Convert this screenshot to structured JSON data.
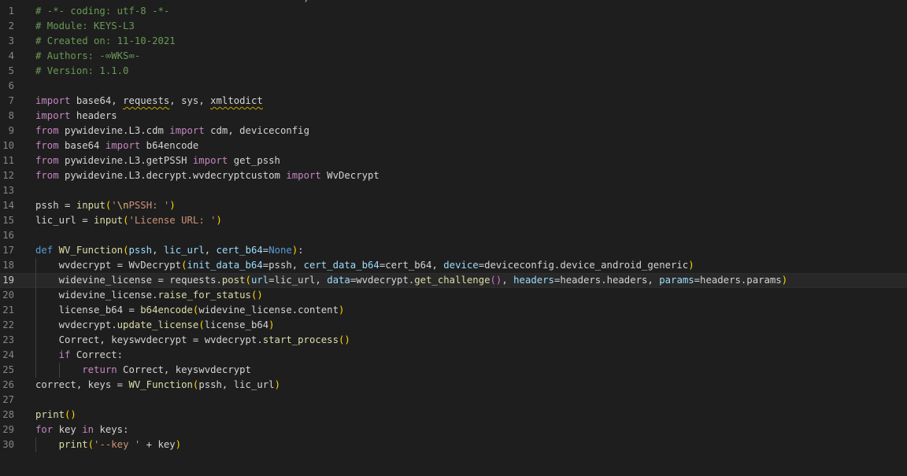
{
  "colors": {
    "background": "#1e1e1e",
    "comment": "#6a9955",
    "keyword": "#c586c0",
    "keyword_blue": "#569cd6",
    "variable": "#9cdcfe",
    "function": "#dcdcaa",
    "string": "#ce9178",
    "escape": "#d7ba7d",
    "bracket": "#ffd700",
    "bracket_inner": "#da70d6",
    "text": "#d4d4d4",
    "line_number": "#858585",
    "warning_squiggle": "#cca700"
  },
  "editor": {
    "clipped_top_text": "                                              )",
    "current_line": 19,
    "lines": [
      {
        "num": "1",
        "indent": 0,
        "tokens": [
          {
            "t": "# -*- coding: utf-8 -*-",
            "c": "comment"
          }
        ]
      },
      {
        "num": "2",
        "indent": 0,
        "tokens": [
          {
            "t": "# Module: KEYS-L3",
            "c": "comment"
          }
        ]
      },
      {
        "num": "3",
        "indent": 0,
        "tokens": [
          {
            "t": "# Created on: 11-10-2021",
            "c": "comment"
          }
        ]
      },
      {
        "num": "4",
        "indent": 0,
        "tokens": [
          {
            "t": "# Authors: -∞WKS∞-",
            "c": "comment"
          }
        ]
      },
      {
        "num": "5",
        "indent": 0,
        "tokens": [
          {
            "t": "# Version: 1.1.0",
            "c": "comment"
          }
        ]
      },
      {
        "num": "6",
        "indent": 0,
        "tokens": []
      },
      {
        "num": "7",
        "indent": 0,
        "tokens": [
          {
            "t": "import",
            "c": "keyword"
          },
          {
            "t": " base64, ",
            "c": "text"
          },
          {
            "t": "requests",
            "c": "text",
            "squiggle": true
          },
          {
            "t": ", sys, ",
            "c": "text"
          },
          {
            "t": "xmltodict",
            "c": "text",
            "squiggle": true
          }
        ]
      },
      {
        "num": "8",
        "indent": 0,
        "tokens": [
          {
            "t": "import",
            "c": "keyword"
          },
          {
            "t": " headers",
            "c": "text"
          }
        ]
      },
      {
        "num": "9",
        "indent": 0,
        "tokens": [
          {
            "t": "from",
            "c": "keyword"
          },
          {
            "t": " pywidevine.L3.cdm ",
            "c": "text"
          },
          {
            "t": "import",
            "c": "keyword"
          },
          {
            "t": " cdm, deviceconfig",
            "c": "text"
          }
        ]
      },
      {
        "num": "10",
        "indent": 0,
        "tokens": [
          {
            "t": "from",
            "c": "keyword"
          },
          {
            "t": " base64 ",
            "c": "text"
          },
          {
            "t": "import",
            "c": "keyword"
          },
          {
            "t": " b64encode",
            "c": "text"
          }
        ]
      },
      {
        "num": "11",
        "indent": 0,
        "tokens": [
          {
            "t": "from",
            "c": "keyword"
          },
          {
            "t": " pywidevine.L3.getPSSH ",
            "c": "text"
          },
          {
            "t": "import",
            "c": "keyword"
          },
          {
            "t": " get_pssh",
            "c": "text"
          }
        ]
      },
      {
        "num": "12",
        "indent": 0,
        "tokens": [
          {
            "t": "from",
            "c": "keyword"
          },
          {
            "t": " pywidevine.L3.decrypt.wvdecryptcustom ",
            "c": "text"
          },
          {
            "t": "import",
            "c": "keyword"
          },
          {
            "t": " WvDecrypt",
            "c": "text"
          }
        ]
      },
      {
        "num": "13",
        "indent": 0,
        "tokens": []
      },
      {
        "num": "14",
        "indent": 0,
        "tokens": [
          {
            "t": "pssh",
            "c": "text"
          },
          {
            "t": " = ",
            "c": "text"
          },
          {
            "t": "input",
            "c": "function"
          },
          {
            "t": "(",
            "c": "bracket"
          },
          {
            "t": "'",
            "c": "string"
          },
          {
            "t": "\\n",
            "c": "escape"
          },
          {
            "t": "PSSH: '",
            "c": "string"
          },
          {
            "t": ")",
            "c": "bracket"
          }
        ]
      },
      {
        "num": "15",
        "indent": 0,
        "tokens": [
          {
            "t": "lic_url",
            "c": "text"
          },
          {
            "t": " = ",
            "c": "text"
          },
          {
            "t": "input",
            "c": "function"
          },
          {
            "t": "(",
            "c": "bracket"
          },
          {
            "t": "'License URL: '",
            "c": "string"
          },
          {
            "t": ")",
            "c": "bracket"
          }
        ]
      },
      {
        "num": "16",
        "indent": 0,
        "tokens": []
      },
      {
        "num": "17",
        "indent": 0,
        "tokens": [
          {
            "t": "def",
            "c": "keyword_blue"
          },
          {
            "t": " ",
            "c": "text"
          },
          {
            "t": "WV_Function",
            "c": "function"
          },
          {
            "t": "(",
            "c": "bracket"
          },
          {
            "t": "pssh",
            "c": "variable"
          },
          {
            "t": ", ",
            "c": "text"
          },
          {
            "t": "lic_url",
            "c": "variable"
          },
          {
            "t": ", ",
            "c": "text"
          },
          {
            "t": "cert_b64",
            "c": "variable"
          },
          {
            "t": "=",
            "c": "text"
          },
          {
            "t": "None",
            "c": "keyword_blue"
          },
          {
            "t": ")",
            "c": "bracket"
          },
          {
            "t": ":",
            "c": "text"
          }
        ]
      },
      {
        "num": "18",
        "indent": 1,
        "tokens": [
          {
            "t": "wvdecrypt = ",
            "c": "text"
          },
          {
            "t": "WvDecrypt",
            "c": "text"
          },
          {
            "t": "(",
            "c": "bracket"
          },
          {
            "t": "init_data_b64",
            "c": "variable"
          },
          {
            "t": "=pssh, ",
            "c": "text"
          },
          {
            "t": "cert_data_b64",
            "c": "variable"
          },
          {
            "t": "=cert_b64, ",
            "c": "text"
          },
          {
            "t": "device",
            "c": "variable"
          },
          {
            "t": "=deviceconfig.device_android_generic",
            "c": "text"
          },
          {
            "t": ")",
            "c": "bracket"
          }
        ]
      },
      {
        "num": "19",
        "indent": 1,
        "tokens": [
          {
            "t": "widevine_license = requests.",
            "c": "text"
          },
          {
            "t": "post",
            "c": "function"
          },
          {
            "t": "(",
            "c": "bracket"
          },
          {
            "t": "url",
            "c": "variable"
          },
          {
            "t": "=lic_url, ",
            "c": "text"
          },
          {
            "t": "data",
            "c": "variable"
          },
          {
            "t": "=wvdecrypt.",
            "c": "text"
          },
          {
            "t": "get_challenge",
            "c": "function"
          },
          {
            "t": "()",
            "c": "bracket_inner"
          },
          {
            "t": ", ",
            "c": "text"
          },
          {
            "t": "headers",
            "c": "variable"
          },
          {
            "t": "=headers.headers, ",
            "c": "text"
          },
          {
            "t": "params",
            "c": "variable"
          },
          {
            "t": "=headers.params",
            "c": "text"
          },
          {
            "t": ")",
            "c": "bracket"
          }
        ]
      },
      {
        "num": "20",
        "indent": 1,
        "tokens": [
          {
            "t": "widevine_license.",
            "c": "text"
          },
          {
            "t": "raise_for_status",
            "c": "function"
          },
          {
            "t": "()",
            "c": "bracket"
          }
        ]
      },
      {
        "num": "21",
        "indent": 1,
        "tokens": [
          {
            "t": "license_b64 = ",
            "c": "text"
          },
          {
            "t": "b64encode",
            "c": "function"
          },
          {
            "t": "(",
            "c": "bracket"
          },
          {
            "t": "widevine_license.content",
            "c": "text"
          },
          {
            "t": ")",
            "c": "bracket"
          }
        ]
      },
      {
        "num": "22",
        "indent": 1,
        "tokens": [
          {
            "t": "wvdecrypt.",
            "c": "text"
          },
          {
            "t": "update_license",
            "c": "function"
          },
          {
            "t": "(",
            "c": "bracket"
          },
          {
            "t": "license_b64",
            "c": "text"
          },
          {
            "t": ")",
            "c": "bracket"
          }
        ]
      },
      {
        "num": "23",
        "indent": 1,
        "tokens": [
          {
            "t": "Correct, keyswvdecrypt = wvdecrypt.",
            "c": "text"
          },
          {
            "t": "start_process",
            "c": "function"
          },
          {
            "t": "()",
            "c": "bracket"
          }
        ]
      },
      {
        "num": "24",
        "indent": 1,
        "tokens": [
          {
            "t": "if",
            "c": "keyword"
          },
          {
            "t": " Correct:",
            "c": "text"
          }
        ]
      },
      {
        "num": "25",
        "indent": 2,
        "tokens": [
          {
            "t": "return",
            "c": "keyword"
          },
          {
            "t": " Correct, keyswvdecrypt",
            "c": "text"
          }
        ]
      },
      {
        "num": "26",
        "indent": 0,
        "tokens": [
          {
            "t": "correct, keys = ",
            "c": "text"
          },
          {
            "t": "WV_Function",
            "c": "function"
          },
          {
            "t": "(",
            "c": "bracket"
          },
          {
            "t": "pssh, lic_url",
            "c": "text"
          },
          {
            "t": ")",
            "c": "bracket"
          }
        ]
      },
      {
        "num": "27",
        "indent": 0,
        "tokens": []
      },
      {
        "num": "28",
        "indent": 0,
        "tokens": [
          {
            "t": "print",
            "c": "function"
          },
          {
            "t": "()",
            "c": "bracket"
          }
        ]
      },
      {
        "num": "29",
        "indent": 0,
        "tokens": [
          {
            "t": "for",
            "c": "keyword"
          },
          {
            "t": " key ",
            "c": "text"
          },
          {
            "t": "in",
            "c": "keyword"
          },
          {
            "t": " keys:",
            "c": "text"
          }
        ]
      },
      {
        "num": "30",
        "indent": 1,
        "tokens": [
          {
            "t": "print",
            "c": "function"
          },
          {
            "t": "(",
            "c": "bracket"
          },
          {
            "t": "'--key '",
            "c": "string"
          },
          {
            "t": " + key",
            "c": "text"
          },
          {
            "t": ")",
            "c": "bracket"
          }
        ]
      }
    ]
  }
}
